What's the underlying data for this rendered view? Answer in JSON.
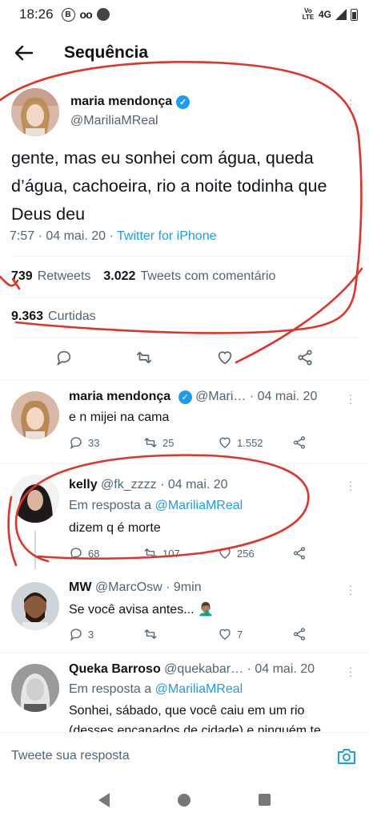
{
  "status_bar": {
    "time": "18:26",
    "b_icon": "B",
    "voicemail_icon": "oo",
    "volte": "Vo LTE",
    "network": "4G"
  },
  "header": {
    "title": "Sequência"
  },
  "main_tweet": {
    "name": "maria mendonça",
    "handle": "@MariliaMReal",
    "text": "gente, mas eu sonhei com água, queda d’água, cachoeira, rio a noite todinha que Deus deu",
    "time_date": "7:57 · 04 mai. 20 · ",
    "source": "Twitter for iPhone",
    "retweets": "739",
    "retweets_label": "Retweets",
    "quotes": "3.022",
    "quotes_label": "Tweets com comentário",
    "likes": "9.363",
    "likes_label": "Curtidas"
  },
  "replies": [
    {
      "name": "maria mendonça",
      "handle_date": "@Mari… · 04 mai. 20",
      "reply_to_label": "",
      "reply_to_handle": "",
      "text": "e n mijei na cama",
      "replies": "33",
      "retweets": "25",
      "likes": "1.552"
    },
    {
      "name": "kelly",
      "handle_date": "@fk_zzzz · 04 mai. 20",
      "reply_to_label": "Em resposta a ",
      "reply_to_handle": "@MariliaMReal",
      "text": "dizem q é morte",
      "replies": "68",
      "retweets": "107",
      "likes": "256"
    },
    {
      "name": "MW",
      "handle_date": "@MarcOsw · 9min",
      "reply_to_label": "",
      "reply_to_handle": "",
      "text": "Se você avisa antes... 🤦🏽‍♂️",
      "replies": "3",
      "retweets": "",
      "likes": "7"
    },
    {
      "name": "Queka Barroso",
      "handle_date": "@quekabar… · 04 mai. 20",
      "reply_to_label": "Em resposta a ",
      "reply_to_handle": "@MariliaMReal",
      "text": "Sonhei, sábado, que você caiu em um rio",
      "text2": "(desses encanados de cidade) e ninguém te"
    }
  ],
  "compose": {
    "placeholder": "Tweete sua resposta"
  },
  "colors": {
    "accent": "#1d9bf0",
    "scribble": "#e0342a",
    "text": "#0f1419",
    "muted": "#536471"
  }
}
